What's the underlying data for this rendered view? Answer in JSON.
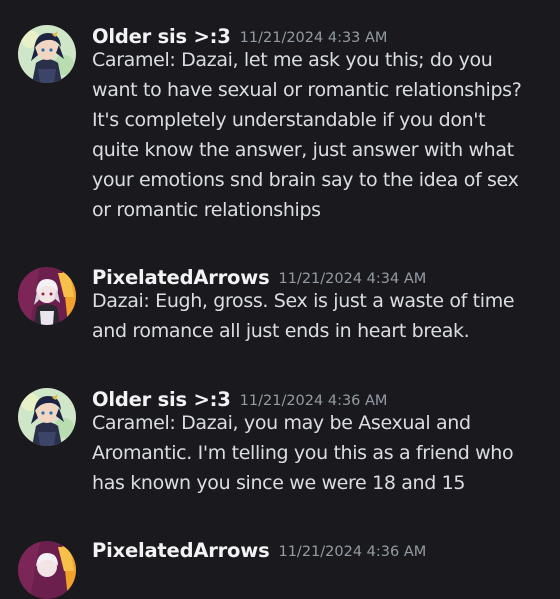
{
  "messages": [
    {
      "author": "Older sis >:3",
      "timestamp": "11/21/2024 4:33 AM",
      "avatar": "avatar-older-sis",
      "lines": [
        "Caramel: Dazai, let me ask you this; do you",
        "want to have sexual or romantic relationships?",
        "It's completely understandable if you don't",
        "quite know the answer, just answer with what",
        "your emotions snd brain say to the idea of sex",
        "or romantic relationships"
      ]
    },
    {
      "author": "PixelatedArrows",
      "timestamp": "11/21/2024 4:34 AM",
      "avatar": "avatar-pixelated-arrows",
      "lines": [
        "Dazai: Eugh, gross. Sex is just a waste of time",
        "and romance all just ends in heart break."
      ]
    },
    {
      "author": "Older sis >:3",
      "timestamp": "11/21/2024 4:36 AM",
      "avatar": "avatar-older-sis",
      "lines": [
        "Caramel: Dazai, you may be Asexual and",
        "Aromantic. I'm telling you this as a friend who",
        "has known you since we were 18 and 15"
      ]
    },
    {
      "author": "PixelatedArrows",
      "timestamp": "11/21/2024 4:36 AM",
      "avatar": "avatar-pixelated-arrows",
      "lines": []
    }
  ],
  "colors": {
    "background": "#1a1a1e",
    "author": "#f2f3f5",
    "timestamp": "#949ba4",
    "text": "#dbdee1"
  }
}
